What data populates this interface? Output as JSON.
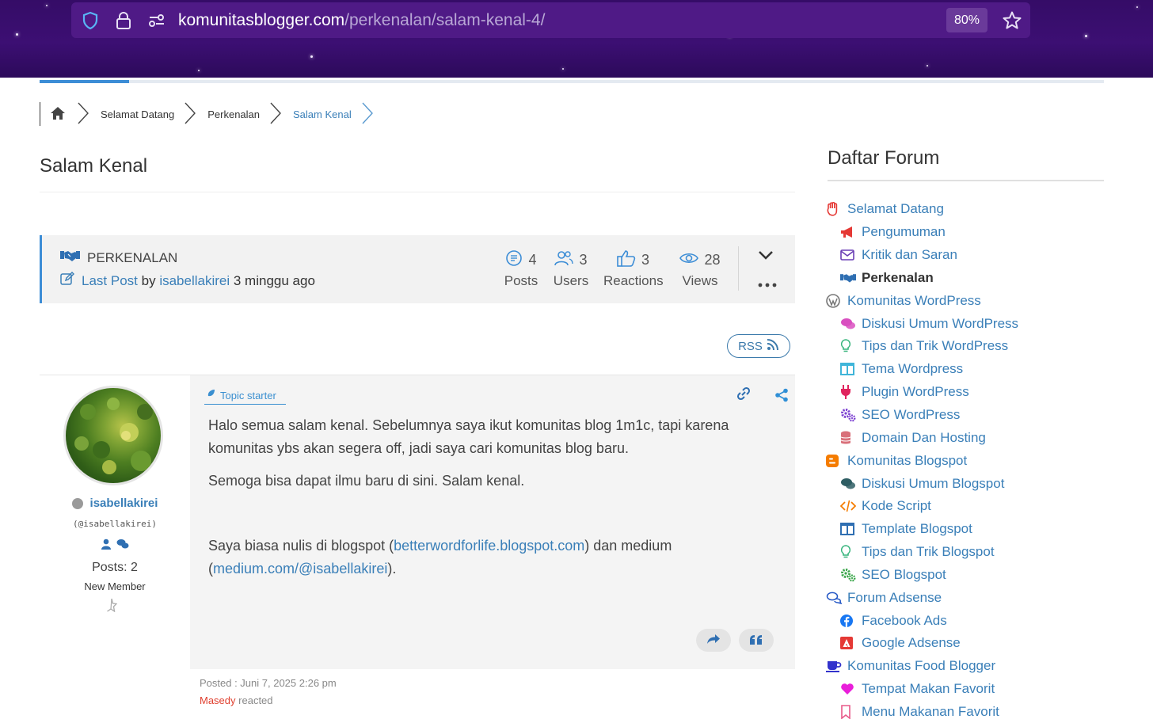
{
  "browser": {
    "url_domain": "komunitasblogger.com",
    "url_path": "/perkenalan/salam-kenal-4/",
    "zoom": "80%"
  },
  "breadcrumb": {
    "items": [
      "Selamat Datang",
      "Perkenalan",
      "Salam Kenal"
    ]
  },
  "page_title": "Salam Kenal",
  "topic_info": {
    "forum_name": "PERKENALAN",
    "last_post_label": "Last Post",
    "by": "by",
    "last_post_user": "isabellakirei",
    "last_post_time": "3 minggu ago",
    "stats": [
      {
        "value": "4",
        "label": "Posts"
      },
      {
        "value": "3",
        "label": "Users"
      },
      {
        "value": "3",
        "label": "Reactions"
      },
      {
        "value": "28",
        "label": "Views"
      }
    ]
  },
  "rss_label": "RSS",
  "post": {
    "author": {
      "name": "isabellakirei",
      "handle": "(@isabellakirei)",
      "posts": "Posts: 2",
      "rank": "New Member"
    },
    "topic_starter_label": "Topic starter",
    "paragraph1": "Halo semua salam kenal. Sebelumnya saya ikut komunitas blog 1m1c, tapi karena komunitas ybs akan segera off, jadi saya cari komunitas blog baru.",
    "paragraph2": "Semoga bisa dapat ilmu baru di sini. Salam kenal.",
    "paragraph3_prefix": "Saya biasa nulis di blogspot (",
    "link1": "betterwordforlife.blogspot.com",
    "paragraph3_mid": ") dan medium (",
    "link2": "medium.com/@isabellakirei",
    "paragraph3_suffix": ").",
    "posted": "Posted : Juni 7, 2025 2:26 pm",
    "reacted_user": "Masedy",
    "reacted_label": "reacted"
  },
  "sidebar": {
    "title": "Daftar Forum",
    "items": [
      {
        "label": "Selamat Datang",
        "icon": "hand-icon",
        "color": "#e53935",
        "sub": false
      },
      {
        "label": "Pengumuman",
        "icon": "megaphone-icon",
        "color": "#e53935",
        "sub": true
      },
      {
        "label": "Kritik dan Saran",
        "icon": "envelope-icon",
        "color": "#6a3fb5",
        "sub": true
      },
      {
        "label": "Perkenalan",
        "icon": "handshake-icon",
        "color": "#2f6fb2",
        "sub": true,
        "active": true
      },
      {
        "label": "Komunitas WordPress",
        "icon": "wordpress-icon",
        "color": "#777777",
        "sub": false
      },
      {
        "label": "Diskusi Umum WordPress",
        "icon": "comments-icon",
        "color": "#d94fc0",
        "sub": true
      },
      {
        "label": "Tips dan Trik WordPress",
        "icon": "lightbulb-icon",
        "color": "#34b37a",
        "sub": true
      },
      {
        "label": "Tema Wordpress",
        "icon": "columns-icon",
        "color": "#3fb5d9",
        "sub": true
      },
      {
        "label": "Plugin WordPress",
        "icon": "plug-icon",
        "color": "#e0245e",
        "sub": true
      },
      {
        "label": "SEO WordPress",
        "icon": "cogs-icon",
        "color": "#7b3fd1",
        "sub": true
      },
      {
        "label": "Domain Dan Hosting",
        "icon": "database-icon",
        "color": "#d9707a",
        "sub": true
      },
      {
        "label": "Komunitas Blogspot",
        "icon": "blogger-icon",
        "color": "#f57c00",
        "sub": false
      },
      {
        "label": "Diskusi Umum Blogspot",
        "icon": "comments-icon",
        "color": "#2e5d63",
        "sub": true
      },
      {
        "label": "Kode Script",
        "icon": "code-icon",
        "color": "#f57c00",
        "sub": true
      },
      {
        "label": "Template Blogspot",
        "icon": "columns-icon",
        "color": "#2f6fb2",
        "sub": true
      },
      {
        "label": "Tips dan Trik Blogspot",
        "icon": "lightbulb-icon",
        "color": "#34b37a",
        "sub": true
      },
      {
        "label": "SEO Blogspot",
        "icon": "cogs-icon",
        "color": "#3aa64a",
        "sub": true
      },
      {
        "label": "Forum Adsense",
        "icon": "comments-outline-icon",
        "color": "#2457c5",
        "sub": false
      },
      {
        "label": "Facebook Ads",
        "icon": "facebook-icon",
        "color": "#1877f2",
        "sub": true
      },
      {
        "label": "Google Adsense",
        "icon": "adobe-icon",
        "color": "#e53935",
        "sub": true
      },
      {
        "label": "Komunitas Food Blogger",
        "icon": "mug-icon",
        "color": "#3333cc",
        "sub": false
      },
      {
        "label": "Tempat Makan Favorit",
        "icon": "heart-icon",
        "color": "#e91eda",
        "sub": true
      },
      {
        "label": "Menu Makanan Favorit",
        "icon": "bookmark-icon",
        "color": "#e85a8a",
        "sub": true
      }
    ]
  }
}
